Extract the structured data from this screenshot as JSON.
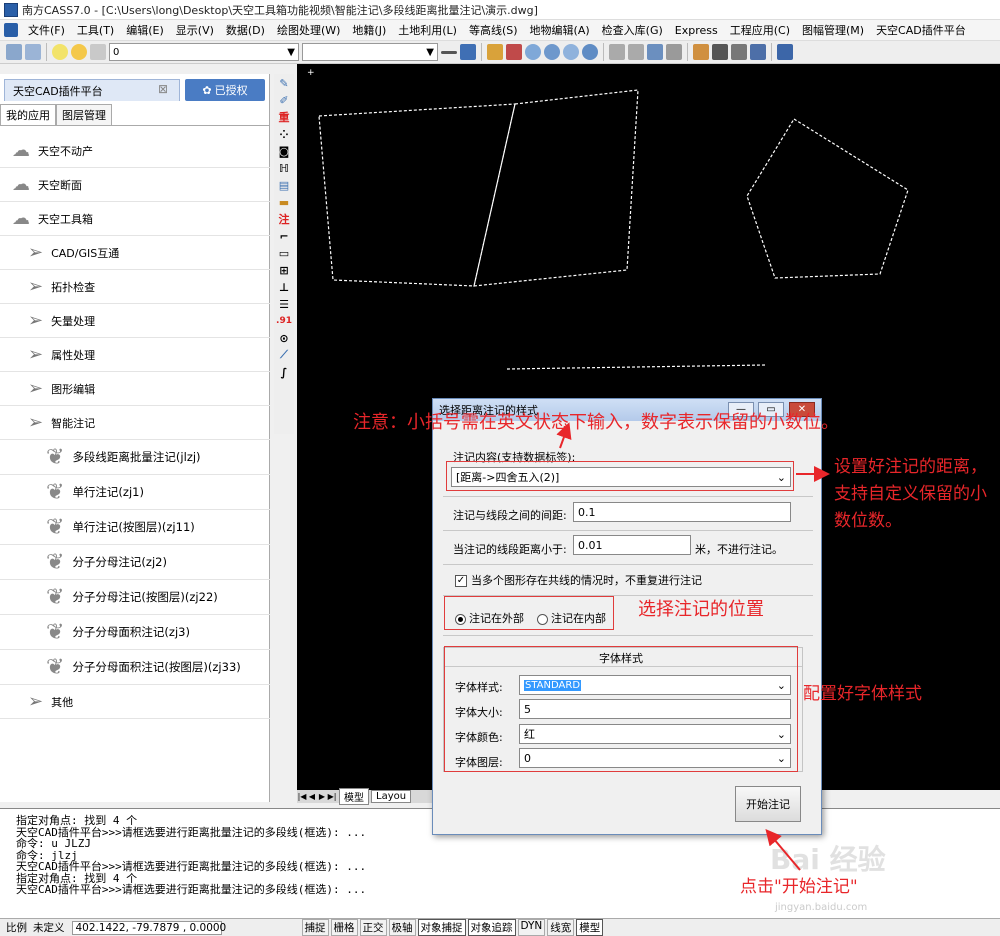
{
  "window": {
    "title": "南方CASS7.0 - [C:\\Users\\long\\Desktop\\天空工具箱功能视频\\智能注记\\多段线距离批量注记\\演示.dwg]"
  },
  "menu": [
    "文件(F)",
    "工具(T)",
    "编辑(E)",
    "显示(V)",
    "数据(D)",
    "绘图处理(W)",
    "地籍(J)",
    "土地利用(L)",
    "等高线(S)",
    "地物编辑(A)",
    "检查入库(G)",
    "Express",
    "工程应用(C)",
    "图幅管理(M)",
    "天空CAD插件平台"
  ],
  "toolbar": {
    "layer_value": "0"
  },
  "panel": {
    "title": "天空CAD插件平台",
    "licensed": "已授权",
    "tabs": [
      "我的应用",
      "图层管理"
    ],
    "items": [
      {
        "label": "天空不动产",
        "level": 0,
        "icon": "cloud-icon"
      },
      {
        "label": "天空断面",
        "level": 0,
        "icon": "cloud-icon"
      },
      {
        "label": "天空工具箱",
        "level": 0,
        "icon": "cloud-icon"
      },
      {
        "label": "CAD/GIS互通",
        "level": 1,
        "icon": "paper-plane-icon"
      },
      {
        "label": "拓扑检查",
        "level": 1,
        "icon": "paper-plane-icon"
      },
      {
        "label": "矢量处理",
        "level": 1,
        "icon": "paper-plane-icon"
      },
      {
        "label": "属性处理",
        "level": 1,
        "icon": "paper-plane-icon"
      },
      {
        "label": "图形编辑",
        "level": 1,
        "icon": "paper-plane-icon"
      },
      {
        "label": "智能注记",
        "level": 1,
        "icon": "paper-plane-icon"
      },
      {
        "label": "多段线距离批量注记(jlzj)",
        "level": 2,
        "icon": "leaf-icon"
      },
      {
        "label": "单行注记(zj1)",
        "level": 2,
        "icon": "leaf-icon"
      },
      {
        "label": "单行注记(按图层)(zj11)",
        "level": 2,
        "icon": "leaf-icon"
      },
      {
        "label": "分子分母注记(zj2)",
        "level": 2,
        "icon": "leaf-icon"
      },
      {
        "label": "分子分母注记(按图层)(zj22)",
        "level": 2,
        "icon": "leaf-icon"
      },
      {
        "label": "分子分母面积注记(zj3)",
        "level": 2,
        "icon": "leaf-icon"
      },
      {
        "label": "分子分母面积注记(按图层)(zj33)",
        "level": 2,
        "icon": "leaf-icon"
      },
      {
        "label": "其他",
        "level": 1,
        "icon": "paper-plane-icon"
      }
    ]
  },
  "vstrip": {
    "red_labels": [
      "重",
      "注",
      ".91"
    ]
  },
  "layout_tabs": {
    "model": "模型",
    "layout": "Layou"
  },
  "dialog": {
    "title": "选择距离注记的样式",
    "content_label": "注记内容(支持数据标签):",
    "content_value": "[距离->四舍五入(2)]",
    "spacing_label": "注记与线段之间的间距:",
    "spacing_value": "0.1",
    "min_length_label": "当注记的线段距离小于:",
    "min_length_value": "0.01",
    "min_length_suffix": "米，不进行注记。",
    "no_repeat_label": "当多个图形存在共线的情况时，不重复进行注记",
    "no_repeat_checked": true,
    "pos_outside": "注记在外部",
    "pos_inside": "注记在内部",
    "pos_selected": "outside",
    "font_group": "字体样式",
    "font_style_label": "字体样式:",
    "font_style_value": "STANDARD",
    "font_size_label": "字体大小:",
    "font_size_value": "5",
    "font_color_label": "字体颜色:",
    "font_color_value": "红",
    "font_layer_label": "字体图层:",
    "font_layer_value": "0",
    "start_button": "开始注记"
  },
  "command_lines": [
    "指定对角点: 找到 4 个",
    "天空CAD插件平台>>>请框选要进行距离批量注记的多段线(框选): ...",
    "命令: u JLZJ",
    "命令: jlzj",
    "天空CAD插件平台>>>请框选要进行距离批量注记的多段线(框选): ...",
    "指定对角点: 找到 4 个",
    "天空CAD插件平台>>>请框选要进行距离批量注记的多段线(框选): ..."
  ],
  "statusbar": {
    "scale_label": "比例",
    "scale_value": "未定义",
    "coords": "402.1422, -79.7879 , 0.0000",
    "toggles": [
      "捕捉",
      "栅格",
      "正交",
      "极轴",
      "对象捕捉",
      "对象追踪",
      "DYN",
      "线宽",
      "模型"
    ]
  },
  "annotations": {
    "note": "注意：小括号需在英文状态下输入，数字表示保留的小数位。",
    "content_tip": "设置好注记的距离，支持自定义保留的小数位数。",
    "position_tip": "选择注记的位置",
    "font_tip": "配置好字体样式",
    "click_tip": "点击\"开始注记\"",
    "watermark": "Bai 经验",
    "watermark_url": "jingyan.baidu.com"
  },
  "colors": {
    "annotation_red": "#e8262a",
    "canvas": "#000000",
    "licensed_blue": "#4a7cc4"
  }
}
